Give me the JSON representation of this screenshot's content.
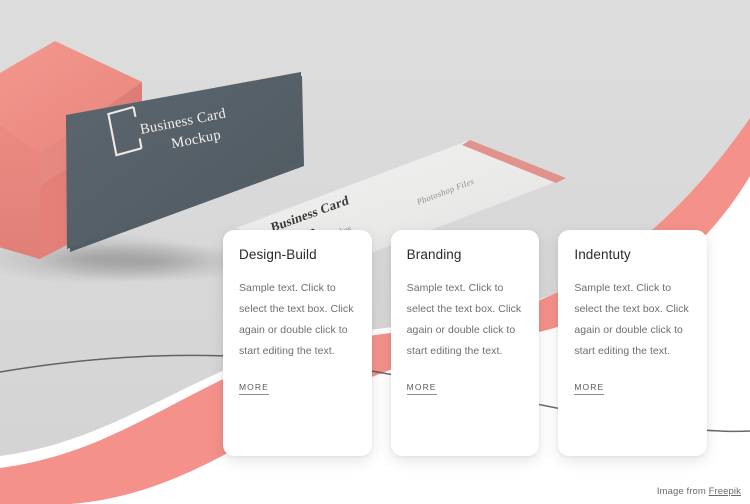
{
  "page": {
    "background_color": "#ffffff",
    "hero_bg_color": "#d9d9d9",
    "accent_pink": "#f4918a",
    "card_dark_color": "#566169"
  },
  "hero": {
    "dark_card": {
      "line1": "Business Card",
      "line2": "Mockup",
      "logo_icon": "square-bracket-logo-icon"
    },
    "light_card": {
      "line1": "Business Card",
      "line2": "Mockup",
      "note": "inches",
      "label": "Photoshop Files"
    }
  },
  "cards": [
    {
      "title": "Design-Build",
      "body": "Sample text. Click to select the text box. Click again or double click to start editing the text.",
      "more_label": "MORE"
    },
    {
      "title": "Branding",
      "body": "Sample text. Click to select the text box. Click again or double click to start editing the text.",
      "more_label": "MORE"
    },
    {
      "title": "Indentuty",
      "body": "Sample text. Click to select the text box. Click again or double click to start editing the text.",
      "more_label": "MORE"
    }
  ],
  "credit": {
    "prefix": "Image from ",
    "link_label": "Freepik"
  }
}
